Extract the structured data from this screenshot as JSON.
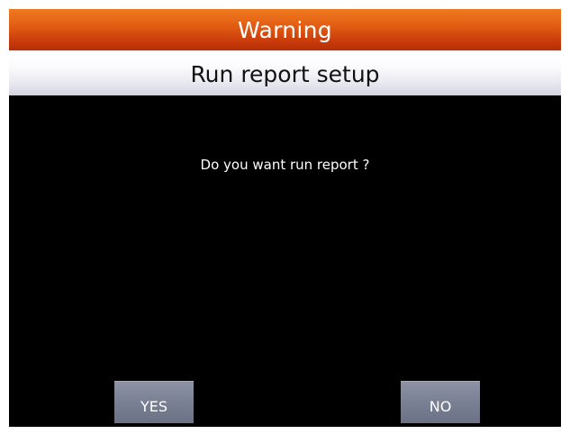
{
  "dialog": {
    "title": "Warning",
    "subtitle": "Run report setup",
    "message": "Do you want run report ?",
    "buttons": {
      "yes_label": "YES",
      "no_label": "NO"
    }
  },
  "colors": {
    "title_bar": "#e05a12",
    "subtitle_bar": "#f0f0f5",
    "background": "#000000",
    "button": "#7a8093"
  }
}
